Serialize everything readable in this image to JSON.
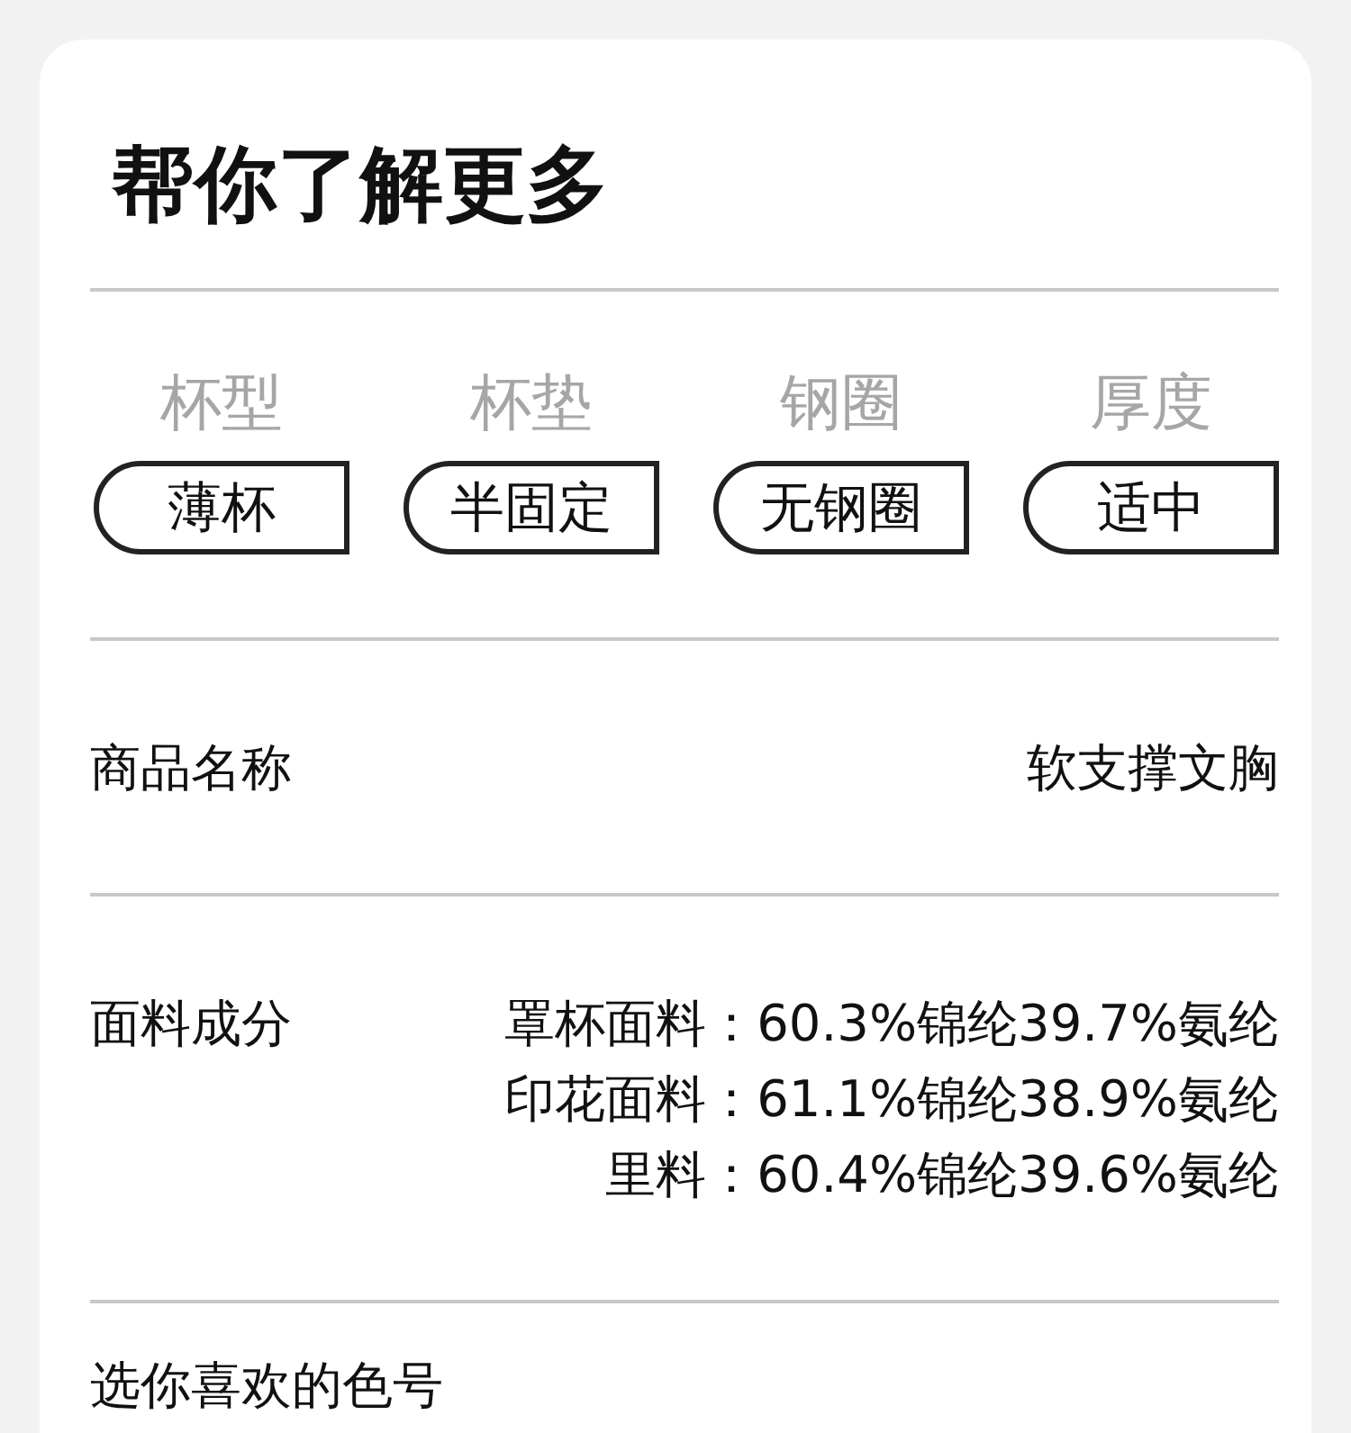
{
  "title": "帮你了解更多",
  "attributes": [
    {
      "label": "杯型",
      "value": "薄杯"
    },
    {
      "label": "杯垫",
      "value": "半固定"
    },
    {
      "label": "钢圈",
      "value": "无钢圈"
    },
    {
      "label": "厚度",
      "value": "适中"
    }
  ],
  "details": [
    {
      "label": "商品名称",
      "lines": [
        "软支撑文胸"
      ]
    },
    {
      "label": "面料成分",
      "lines": [
        "罩杯面料：60.3%锦纶39.7%氨纶",
        "印花面料：61.1%锦纶38.9%氨纶",
        "里料：60.4%锦纶39.6%氨纶"
      ]
    }
  ],
  "color_section": {
    "title": "选你喜欢的色号"
  }
}
